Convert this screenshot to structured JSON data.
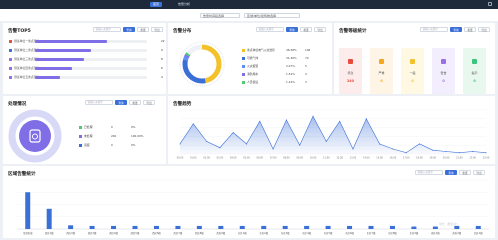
{
  "top_tabs": [
    "首页",
    "告警分析"
  ],
  "filters": {
    "range": "告警时间段选择",
    "region": "区域/单位/建筑物选择"
  },
  "search_placeholder": "请输入关键字",
  "btn_query": "查询",
  "btn_reset": "重置",
  "btn_export": "导出",
  "panel_top5": {
    "title": "告警TOP5",
    "items": [
      {
        "label": "测试单位一重点部位",
        "value": "22",
        "ratio": 0.64
      },
      {
        "label": "测试单位二重点部位",
        "value": "9",
        "ratio": 0.5
      },
      {
        "label": "测试单位三重点部位",
        "value": "8",
        "ratio": 0.44
      },
      {
        "label": "测试单位四重点部位",
        "value": "6",
        "ratio": 0.33
      },
      {
        "label": "测试单位五重点部位",
        "value": "4",
        "ratio": 0.22
      }
    ],
    "dot_colors": [
      "#e74c3c",
      "#3b6fd8",
      "#8e6ee6",
      "#8e6ee6",
      "#8e6ee6"
    ]
  },
  "panel_distribution": {
    "title": "告警分布",
    "legend": [
      {
        "label": "重点单位电气火灾监控",
        "pct": "46.58%",
        "count": "106",
        "color": "#f3c22a"
      },
      {
        "label": "可燃气体",
        "pct": "31.46%",
        "count": "70",
        "color": "#3b6fd8"
      },
      {
        "label": "火灾报警",
        "pct": "2.07%",
        "count": "5",
        "color": "#5b8ff9"
      },
      {
        "label": "消防用水",
        "pct": "1.54%",
        "count": "4",
        "color": "#7f6ee6"
      },
      {
        "label": "人员值班",
        "pct": "1.24%",
        "count": "3",
        "color": "#4ecb73"
      }
    ]
  },
  "panel_levels": {
    "title": "告警等级统计",
    "cards": [
      {
        "name": "紧急",
        "value": "240",
        "color": "#e74c3c",
        "bg": "#fdecec"
      },
      {
        "name": "严重",
        "value": "0",
        "color": "#f5a623",
        "bg": "#fff5e6"
      },
      {
        "name": "一般",
        "value": "0",
        "color": "#f3c22a",
        "bg": "#fff9e3"
      },
      {
        "name": "警告",
        "value": "0",
        "color": "#9b6ee6",
        "bg": "#f3eefd"
      },
      {
        "name": "提示",
        "value": "0",
        "color": "#3ac47d",
        "bg": "#e9f8ef"
      }
    ]
  },
  "panel_handling": {
    "title": "处理情况",
    "legend": [
      {
        "label": "已处理",
        "count": "0",
        "pct": "0%",
        "color": "#4ecb73"
      },
      {
        "label": "未处理",
        "count": "240",
        "pct": "100.00%",
        "color": "#7f6ee6"
      },
      {
        "label": "误报",
        "count": "0",
        "pct": "0%",
        "color": "#3b6fd8"
      }
    ]
  },
  "panel_trend": {
    "title": "告警趋势"
  },
  "panel_region": {
    "title": "区域告警统计",
    "watermark": "单位：(数量/次)"
  },
  "chart_data": [
    {
      "type": "area",
      "title": "告警趋势",
      "x": [
        "00:00",
        "01:00",
        "02:00",
        "03:00",
        "04:00",
        "05:00",
        "06:00",
        "07:00",
        "08:00",
        "09:00",
        "10:00",
        "11:00",
        "12:00",
        "13:00",
        "14:00",
        "15:00",
        "16:00",
        "17:00",
        "18:00",
        "19:00",
        "20:00",
        "21:00",
        "22:00",
        "23:00"
      ],
      "values": [
        8,
        24,
        10,
        5,
        17,
        8,
        26,
        4,
        27,
        7,
        30,
        10,
        26,
        4,
        28,
        8,
        4,
        1,
        8,
        3,
        2,
        1,
        2,
        1
      ],
      "ylim": [
        0,
        35
      ],
      "grid": true
    },
    {
      "type": "bar",
      "title": "区域告警统计",
      "categories": [
        "吊顶区域",
        "西区1楼",
        "西区2楼",
        "西区3楼",
        "西区4楼",
        "西区5楼",
        "西区6楼",
        "西区7楼",
        "西区8楼",
        "西区9楼",
        "东区1楼",
        "东区2楼",
        "东区3楼",
        "东区4楼",
        "东区5楼",
        "东区6楼",
        "东区7楼",
        "东区8楼",
        "东区9楼",
        "南区1楼",
        "南区2楼",
        "北区1楼"
      ],
      "values": [
        60,
        33,
        6,
        5,
        5,
        5,
        5,
        5,
        5,
        5,
        5,
        5,
        5,
        5,
        5,
        5,
        5,
        5,
        4,
        4,
        5,
        5
      ],
      "ylim": [
        0,
        80
      ],
      "grid": true
    }
  ]
}
